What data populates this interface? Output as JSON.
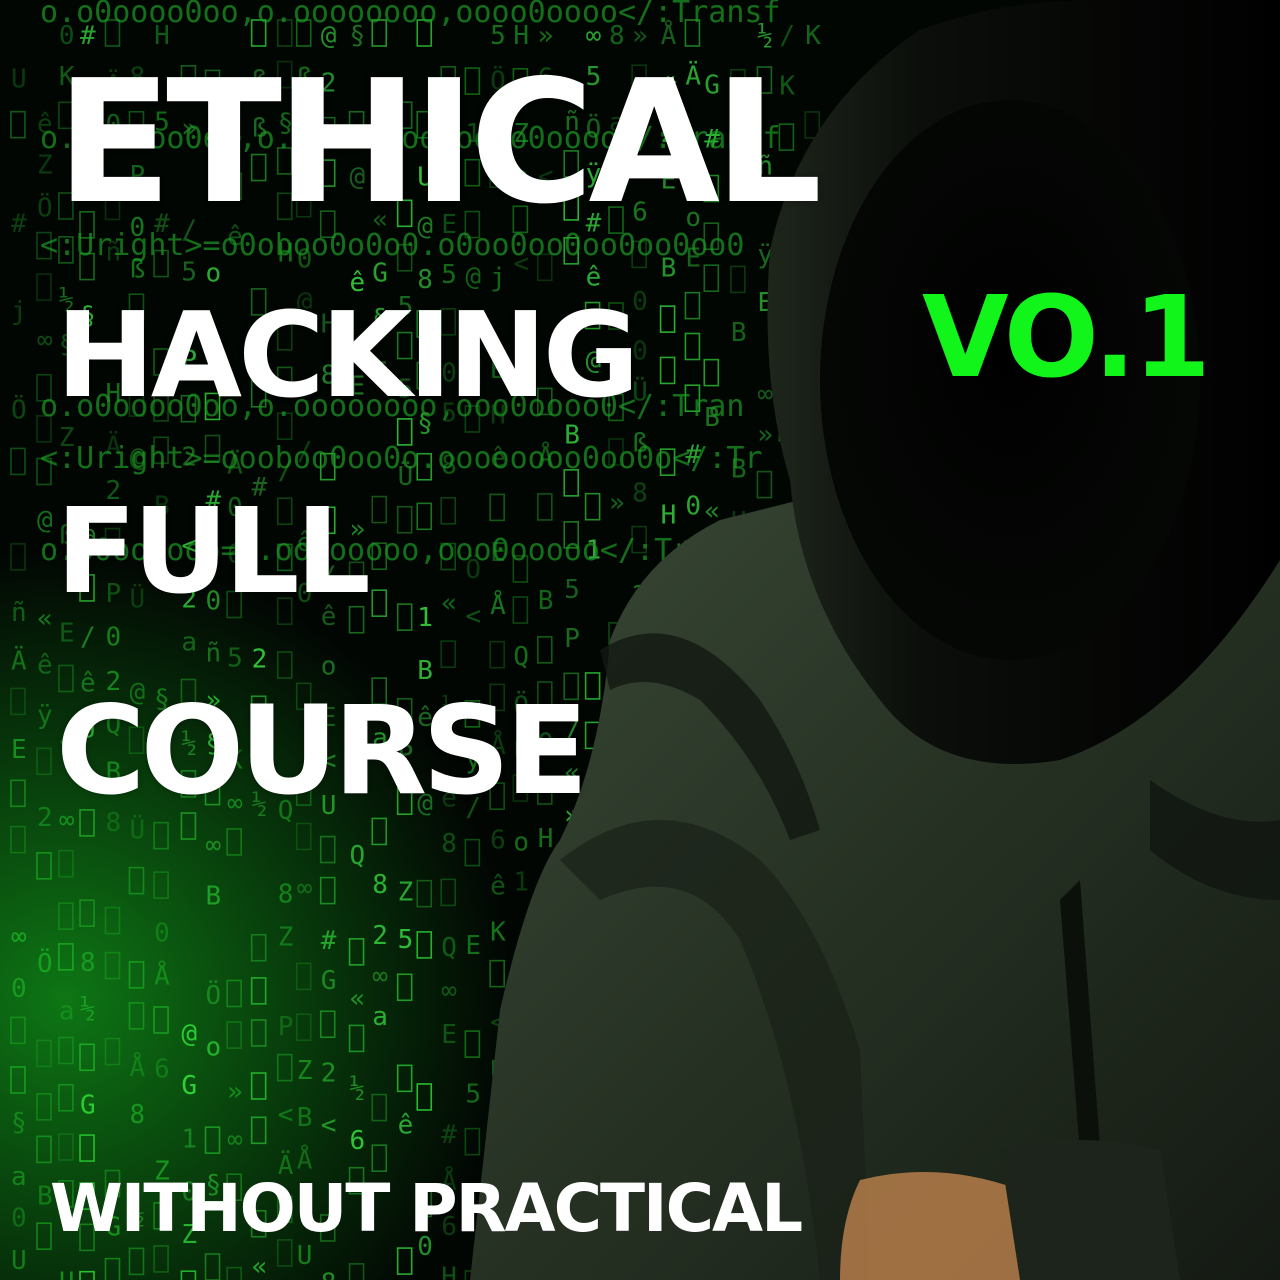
{
  "poster": {
    "headline_lines": [
      "ETHICAL",
      "HACKING",
      "FULL",
      "COURSE"
    ],
    "volume_label": "VO.1",
    "subtitle": "WITHOUT PRACTICAL"
  },
  "colors": {
    "background": "#020502",
    "matrix_green": "#1fb72a",
    "accent_green": "#12f51a",
    "headline_text": "#ffffff",
    "hoodie": "#2a3528"
  },
  "background": {
    "matrix_code_rows": [
      "o.o0oooo0oo,o.oooooooo,oooo0oooo</:Transf",
      "<:Uright>=o0oboo0o0o0.o0oo0oo0oo0oo0oo0",
      "o.o0oooo0oo,o.oooooooo,ooo0oooo0</:Tran",
      "<:Uright>=oooboo0oo0o.oooooooo0oo0o</:Tr",
      "o.o0oooooo=o.oooooooo,ooo0ooooo</:Transf",
      "o.o0oooo0oo,o.oooooooo,oooo0oooo</:Transf"
    ]
  }
}
